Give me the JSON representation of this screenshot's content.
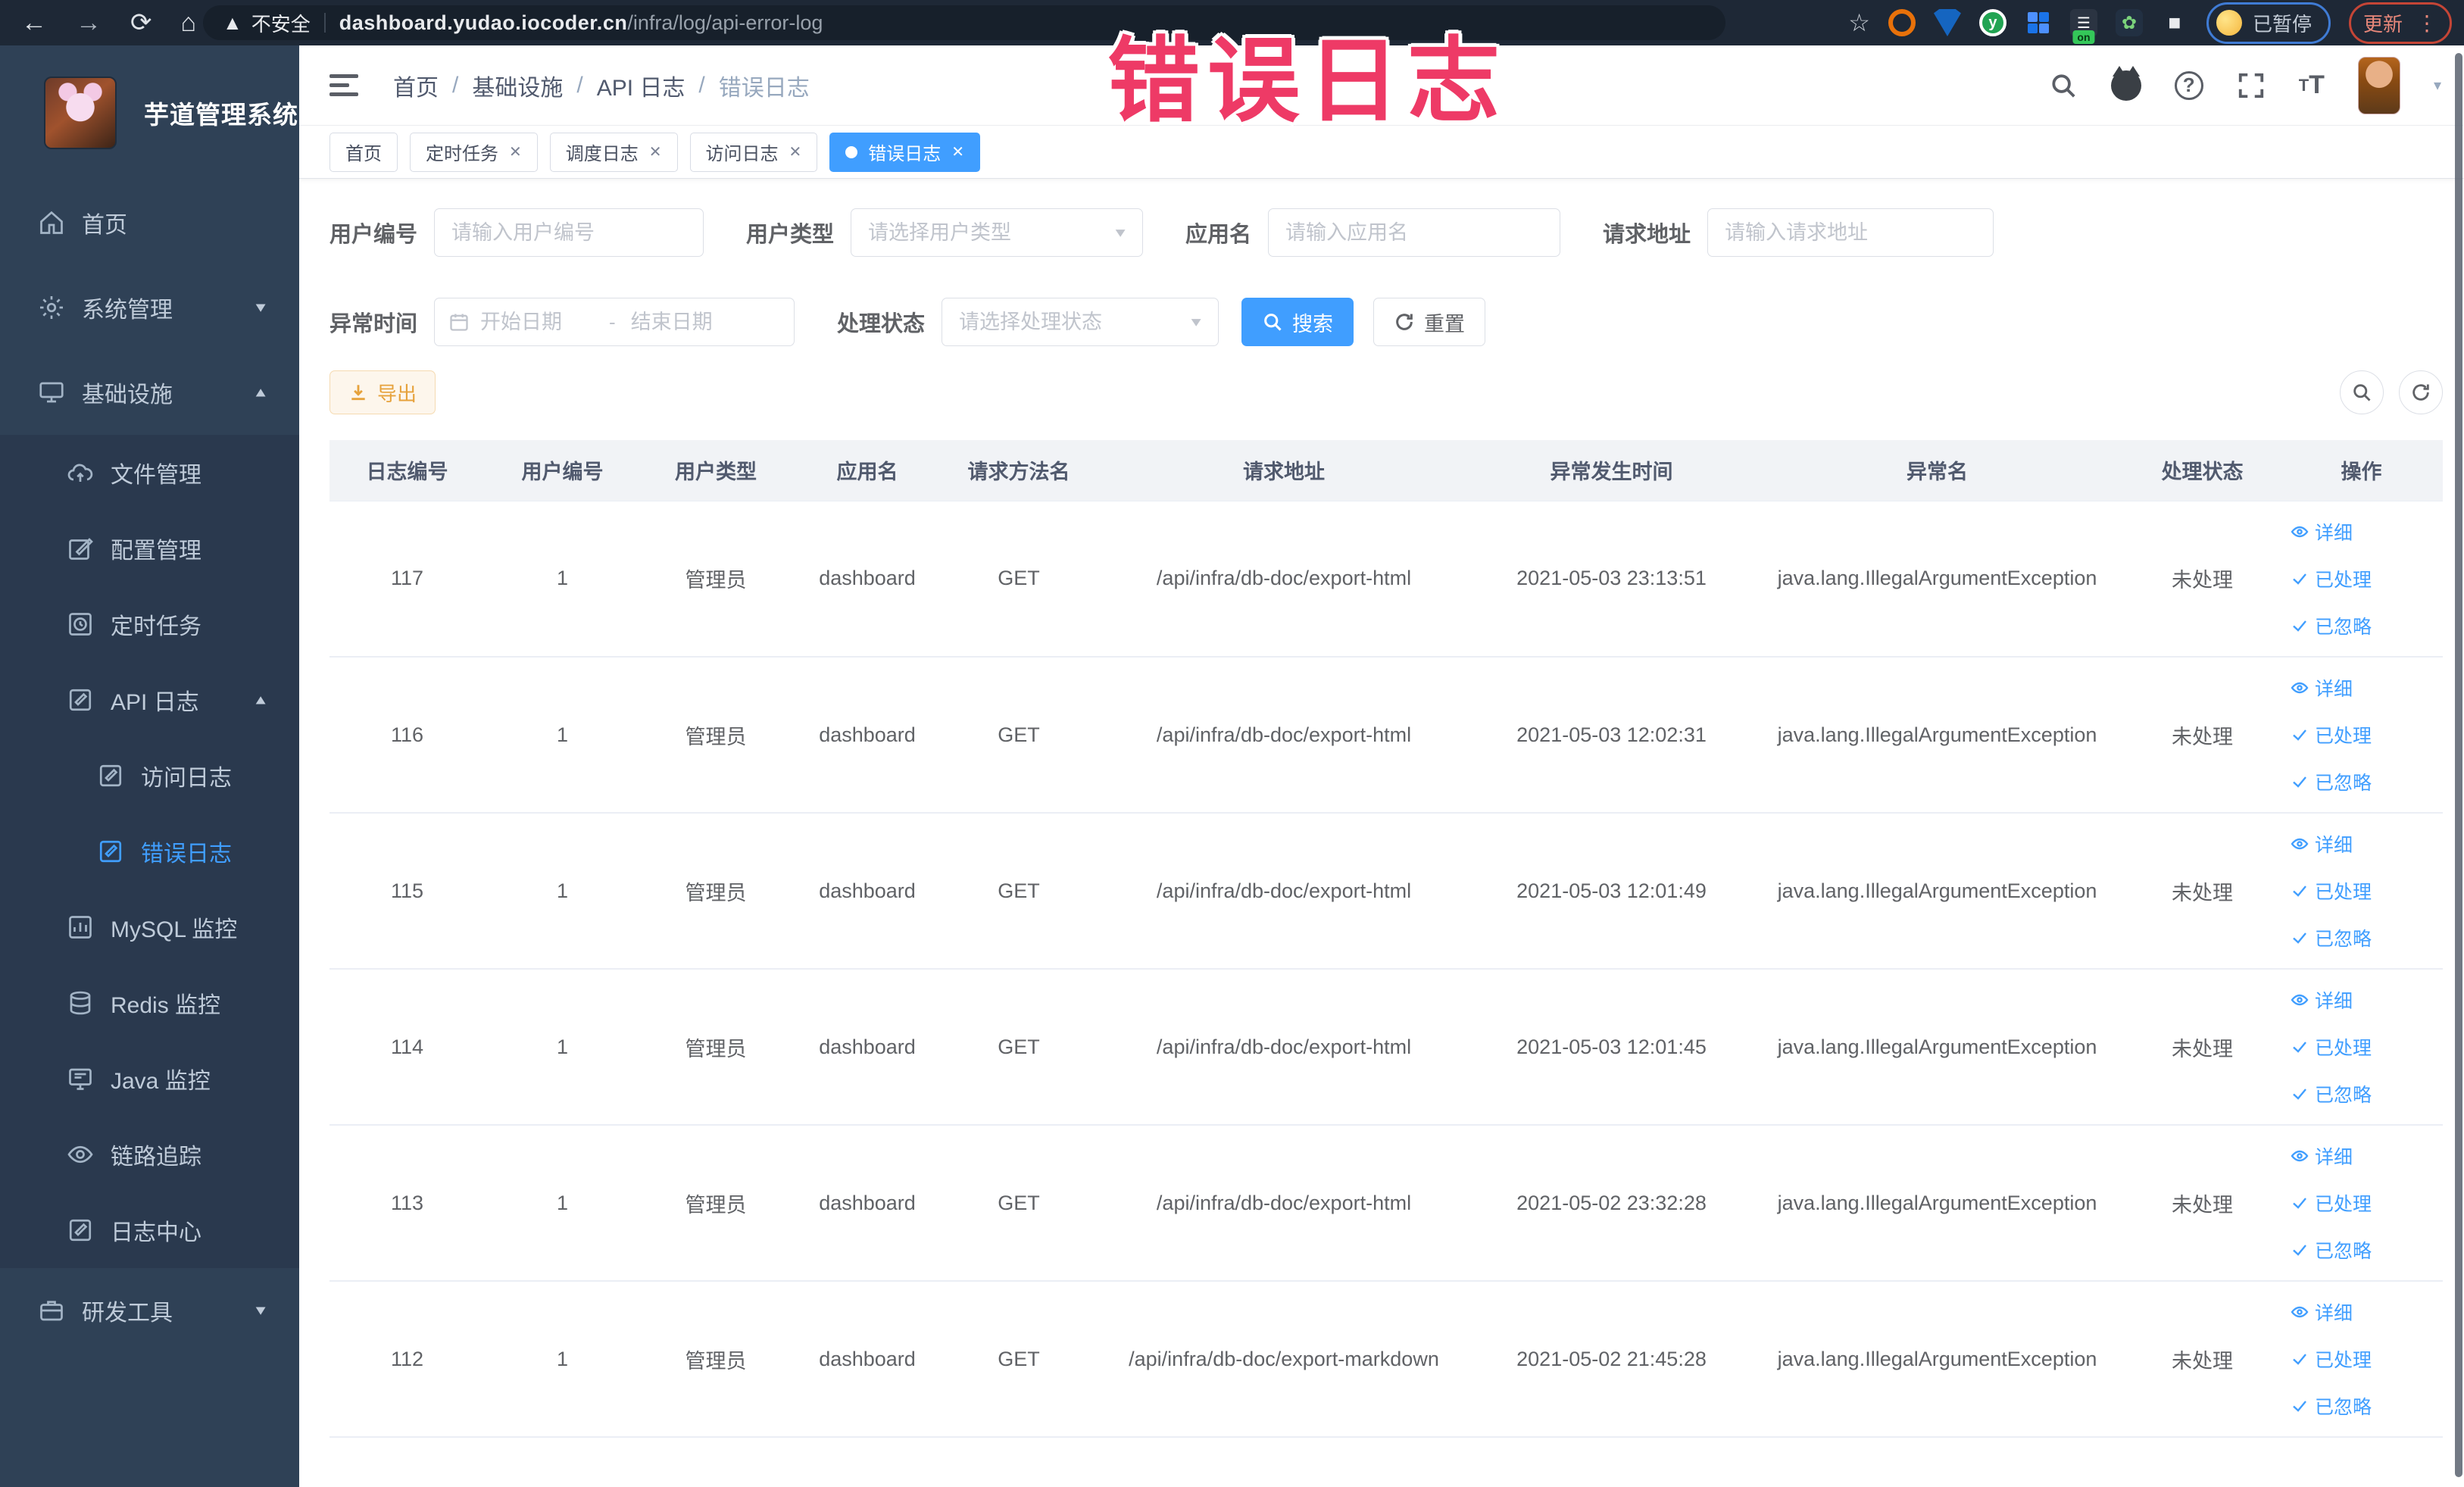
{
  "colors": {
    "accent": "#409eff",
    "warning": "#e6a23c",
    "annotation": "#ee3a66",
    "sidebar_bg": "#2f4156"
  },
  "browser": {
    "security_label": "不安全",
    "url_domain": "dashboard.yudao.iocoder.cn",
    "url_path": "/infra/log/api-error-log",
    "paused_badge": "已暂停",
    "update_button": "更新",
    "extension_on_badge": "on"
  },
  "annotation": {
    "title": "错误日志"
  },
  "sidebar": {
    "app_title": "芋道管理系统",
    "items": [
      {
        "label": "首页"
      },
      {
        "label": "系统管理"
      },
      {
        "label": "基础设施"
      },
      {
        "label": "文件管理"
      },
      {
        "label": "配置管理"
      },
      {
        "label": "定时任务"
      },
      {
        "label": "API 日志"
      },
      {
        "label": "访问日志"
      },
      {
        "label": "错误日志"
      },
      {
        "label": "MySQL 监控"
      },
      {
        "label": "Redis 监控"
      },
      {
        "label": "Java 监控"
      },
      {
        "label": "链路追踪"
      },
      {
        "label": "日志中心"
      },
      {
        "label": "研发工具"
      }
    ]
  },
  "breadcrumb": {
    "items": [
      "首页",
      "基础设施",
      "API 日志",
      "错误日志"
    ]
  },
  "tabs": [
    {
      "label": "首页"
    },
    {
      "label": "定时任务"
    },
    {
      "label": "调度日志"
    },
    {
      "label": "访问日志"
    },
    {
      "label": "错误日志"
    }
  ],
  "filters": {
    "user_id": {
      "label": "用户编号",
      "placeholder": "请输入用户编号"
    },
    "user_type": {
      "label": "用户类型",
      "placeholder": "请选择用户类型"
    },
    "app_name": {
      "label": "应用名",
      "placeholder": "请输入应用名"
    },
    "request_url": {
      "label": "请求地址",
      "placeholder": "请输入请求地址"
    },
    "exception_time": {
      "label": "异常时间",
      "start_placeholder": "开始日期",
      "end_placeholder": "结束日期",
      "separator": "-"
    },
    "process_status": {
      "label": "处理状态",
      "placeholder": "请选择处理状态"
    },
    "search_button": "搜索",
    "reset_button": "重置"
  },
  "toolbar": {
    "export_button": "导出"
  },
  "table": {
    "columns": [
      "日志编号",
      "用户编号",
      "用户类型",
      "应用名",
      "请求方法名",
      "请求地址",
      "异常发生时间",
      "异常名",
      "处理状态",
      "操作"
    ],
    "actions": {
      "detail": "详细",
      "processed": "已处理",
      "ignored": "已忽略"
    },
    "rows": [
      {
        "id": "117",
        "user_id": "1",
        "user_type": "管理员",
        "app": "dashboard",
        "method": "GET",
        "url": "/api/infra/db-doc/export-html",
        "time": "2021-05-03 23:13:51",
        "exception": "java.lang.IllegalArgumentException",
        "status": "未处理"
      },
      {
        "id": "116",
        "user_id": "1",
        "user_type": "管理员",
        "app": "dashboard",
        "method": "GET",
        "url": "/api/infra/db-doc/export-html",
        "time": "2021-05-03 12:02:31",
        "exception": "java.lang.IllegalArgumentException",
        "status": "未处理"
      },
      {
        "id": "115",
        "user_id": "1",
        "user_type": "管理员",
        "app": "dashboard",
        "method": "GET",
        "url": "/api/infra/db-doc/export-html",
        "time": "2021-05-03 12:01:49",
        "exception": "java.lang.IllegalArgumentException",
        "status": "未处理"
      },
      {
        "id": "114",
        "user_id": "1",
        "user_type": "管理员",
        "app": "dashboard",
        "method": "GET",
        "url": "/api/infra/db-doc/export-html",
        "time": "2021-05-03 12:01:45",
        "exception": "java.lang.IllegalArgumentException",
        "status": "未处理"
      },
      {
        "id": "113",
        "user_id": "1",
        "user_type": "管理员",
        "app": "dashboard",
        "method": "GET",
        "url": "/api/infra/db-doc/export-html",
        "time": "2021-05-02 23:32:28",
        "exception": "java.lang.IllegalArgumentException",
        "status": "未处理"
      },
      {
        "id": "112",
        "user_id": "1",
        "user_type": "管理员",
        "app": "dashboard",
        "method": "GET",
        "url": "/api/infra/db-doc/export-markdown",
        "time": "2021-05-02 21:45:28",
        "exception": "java.lang.IllegalArgumentException",
        "status": "未处理"
      }
    ]
  }
}
